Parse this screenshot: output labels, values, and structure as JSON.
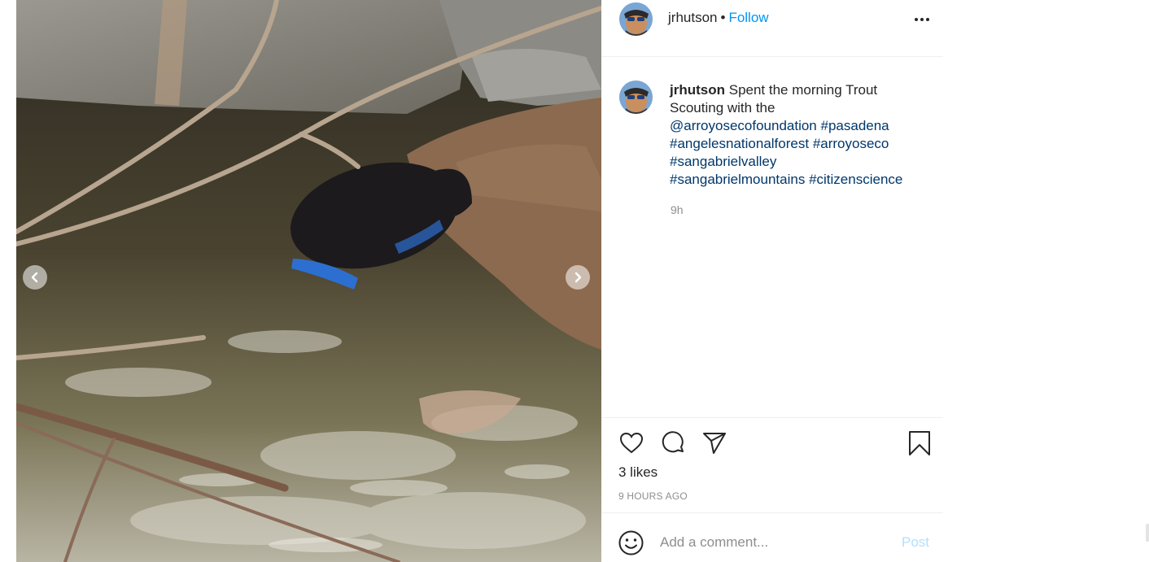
{
  "post": {
    "username": "jrhutson",
    "separator": "•",
    "follow_label": "Follow",
    "caption_user": "jrhutson",
    "caption_text": "Spent the morning Trout Scouting with the",
    "mentions": [
      "@arroyosecofoundation",
      "#pasadena",
      "#angelesnationalforest",
      "#arroyoseco",
      "#sangabrielvalley",
      "#sangabrielmountains",
      "#citizenscience"
    ],
    "caption_time": "9h",
    "likes": "3 likes",
    "time_ago": "9 HOURS AGO"
  },
  "comment": {
    "placeholder": "Add a comment...",
    "post_label": "Post"
  },
  "icons": {
    "more": "more-options-icon",
    "like": "heart-icon",
    "comment": "comment-bubble-icon",
    "share": "paper-plane-icon",
    "save": "bookmark-icon",
    "emoji": "emoji-smile-icon",
    "prev": "chevron-left-icon",
    "next": "chevron-right-icon"
  },
  "colors": {
    "link_blue": "#0095f6",
    "hashtag_blue": "#00376b",
    "muted_gray": "#8e8e8e",
    "post_disabled": "#b2dffc"
  }
}
